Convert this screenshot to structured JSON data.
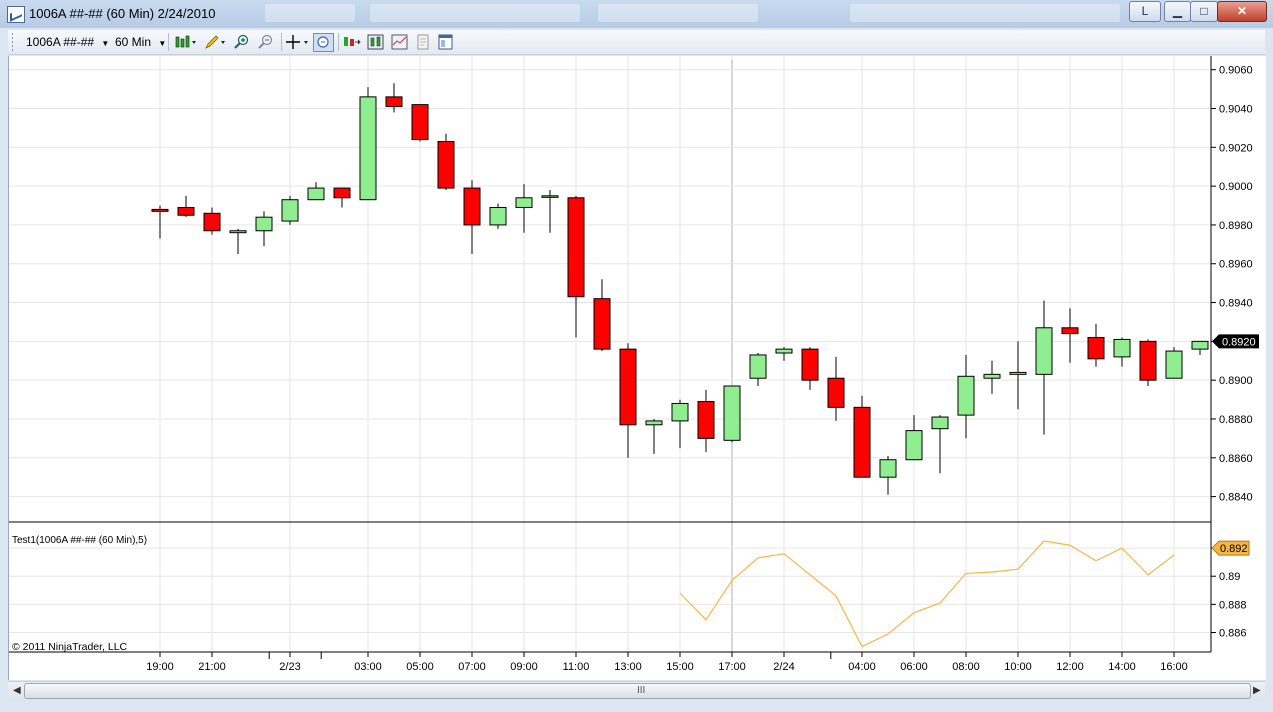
{
  "window": {
    "title": "1006A ##-## (60 Min)  2/24/2010",
    "buttons": {
      "layout": "L",
      "minimize": "▁",
      "maximize": "□",
      "close": "✕"
    }
  },
  "toolbar": {
    "instrument": "1006A ##-##",
    "interval": "60 Min",
    "icons": [
      "candlestick-icon",
      "pencil-icon",
      "zoom-in-icon",
      "zoom-out-icon",
      "crosshair-icon",
      "data-box-icon",
      "bar-spacing-icon",
      "chart-style-icon",
      "indicators-icon",
      "strategies-icon",
      "properties-icon"
    ]
  },
  "chart_data": {
    "type": "candlestick",
    "x_tick_labels": [
      "19:00",
      "21:00",
      "2/23",
      "03:00",
      "05:00",
      "07:00",
      "09:00",
      "11:00",
      "13:00",
      "15:00",
      "17:00",
      "2/24",
      "04:00",
      "06:00",
      "08:00",
      "10:00",
      "12:00",
      "14:00",
      "16:00"
    ],
    "price_ticks": [
      "0.9060",
      "0.9040",
      "0.9020",
      "0.9000",
      "0.8980",
      "0.8960",
      "0.8940",
      "0.8920",
      "0.8900",
      "0.8880",
      "0.8860",
      "0.8840"
    ],
    "ylim": [
      0.883,
      0.9065
    ],
    "last_price": "0.8920",
    "colors": {
      "up": "#90ee90",
      "down": "#ff0000",
      "indicator": "#f5b642",
      "grid": "#e6e6e6"
    },
    "candles": [
      {
        "o": 0.8988,
        "h": 0.899,
        "l": 0.8973,
        "c": 0.8987
      },
      {
        "o": 0.8989,
        "h": 0.8995,
        "l": 0.8984,
        "c": 0.8985
      },
      {
        "o": 0.8986,
        "h": 0.8989,
        "l": 0.8975,
        "c": 0.8977
      },
      {
        "o": 0.8976,
        "h": 0.8978,
        "l": 0.8965,
        "c": 0.8977
      },
      {
        "o": 0.8977,
        "h": 0.8987,
        "l": 0.8969,
        "c": 0.8984
      },
      {
        "o": 0.8982,
        "h": 0.8995,
        "l": 0.898,
        "c": 0.8993
      },
      {
        "o": 0.8993,
        "h": 0.9002,
        "l": 0.8993,
        "c": 0.8999
      },
      {
        "o": 0.8999,
        "h": 0.8999,
        "l": 0.8989,
        "c": 0.8994
      },
      {
        "o": 0.8993,
        "h": 0.9051,
        "l": 0.8993,
        "c": 0.9046
      },
      {
        "o": 0.9046,
        "h": 0.9053,
        "l": 0.9038,
        "c": 0.9041
      },
      {
        "o": 0.9042,
        "h": 0.9042,
        "l": 0.9023,
        "c": 0.9024
      },
      {
        "o": 0.9023,
        "h": 0.9027,
        "l": 0.8998,
        "c": 0.8999
      },
      {
        "o": 0.8999,
        "h": 0.9003,
        "l": 0.8965,
        "c": 0.898
      },
      {
        "o": 0.898,
        "h": 0.8991,
        "l": 0.8978,
        "c": 0.8989
      },
      {
        "o": 0.8989,
        "h": 0.9001,
        "l": 0.8976,
        "c": 0.8994
      },
      {
        "o": 0.8995,
        "h": 0.8998,
        "l": 0.8976,
        "c": 0.8995
      },
      {
        "o": 0.8994,
        "h": 0.8995,
        "l": 0.8922,
        "c": 0.8943
      },
      {
        "o": 0.8942,
        "h": 0.8952,
        "l": 0.8915,
        "c": 0.8916
      },
      {
        "o": 0.8916,
        "h": 0.8919,
        "l": 0.886,
        "c": 0.8877
      },
      {
        "o": 0.8877,
        "h": 0.888,
        "l": 0.8862,
        "c": 0.8879
      },
      {
        "o": 0.8879,
        "h": 0.889,
        "l": 0.8865,
        "c": 0.8888
      },
      {
        "o": 0.8889,
        "h": 0.8895,
        "l": 0.8863,
        "c": 0.887
      },
      {
        "o": 0.8869,
        "h": 0.8897,
        "l": 0.8868,
        "c": 0.8897
      },
      {
        "o": 0.8901,
        "h": 0.8914,
        "l": 0.8897,
        "c": 0.8913
      },
      {
        "o": 0.8914,
        "h": 0.8917,
        "l": 0.891,
        "c": 0.8916
      },
      {
        "o": 0.8916,
        "h": 0.8917,
        "l": 0.8895,
        "c": 0.89
      },
      {
        "o": 0.8901,
        "h": 0.8912,
        "l": 0.8879,
        "c": 0.8886
      },
      {
        "o": 0.8886,
        "h": 0.8892,
        "l": 0.885,
        "c": 0.885
      },
      {
        "o": 0.885,
        "h": 0.8861,
        "l": 0.8841,
        "c": 0.8859
      },
      {
        "o": 0.8859,
        "h": 0.8882,
        "l": 0.8859,
        "c": 0.8874
      },
      {
        "o": 0.8875,
        "h": 0.8882,
        "l": 0.8852,
        "c": 0.8881
      },
      {
        "o": 0.8882,
        "h": 0.8913,
        "l": 0.887,
        "c": 0.8902
      },
      {
        "o": 0.8901,
        "h": 0.891,
        "l": 0.8893,
        "c": 0.8903
      },
      {
        "o": 0.8903,
        "h": 0.892,
        "l": 0.8885,
        "c": 0.8904
      },
      {
        "o": 0.8903,
        "h": 0.8941,
        "l": 0.8872,
        "c": 0.8927
      },
      {
        "o": 0.8927,
        "h": 0.8937,
        "l": 0.8909,
        "c": 0.8924
      },
      {
        "o": 0.8922,
        "h": 0.8929,
        "l": 0.8907,
        "c": 0.8911
      },
      {
        "o": 0.8912,
        "h": 0.8922,
        "l": 0.8907,
        "c": 0.8921
      },
      {
        "o": 0.892,
        "h": 0.8921,
        "l": 0.8897,
        "c": 0.89
      },
      {
        "o": 0.8901,
        "h": 0.8917,
        "l": 0.8901,
        "c": 0.8915
      },
      {
        "o": 0.8916,
        "h": 0.892,
        "l": 0.8913,
        "c": 0.892
      }
    ],
    "indicator": {
      "name": "Test1(1006A ##-## (60 Min),5)",
      "last_value": "0.892",
      "ticks": [
        "0.892",
        "0.89",
        "0.888",
        "0.886"
      ],
      "ylim": [
        0.8849,
        0.893
      ],
      "start_index": 20,
      "values": [
        0.8888,
        0.8869,
        0.8897,
        0.8913,
        0.8916,
        0.8901,
        0.8886,
        0.885,
        0.8859,
        0.8874,
        0.8881,
        0.8902,
        0.8903,
        0.8905,
        0.8925,
        0.8922,
        0.8911,
        0.892,
        0.8901,
        0.8915
      ]
    }
  },
  "copyright": "© 2011 NinjaTrader, LLC",
  "scrollbar": {
    "grip": "III"
  }
}
